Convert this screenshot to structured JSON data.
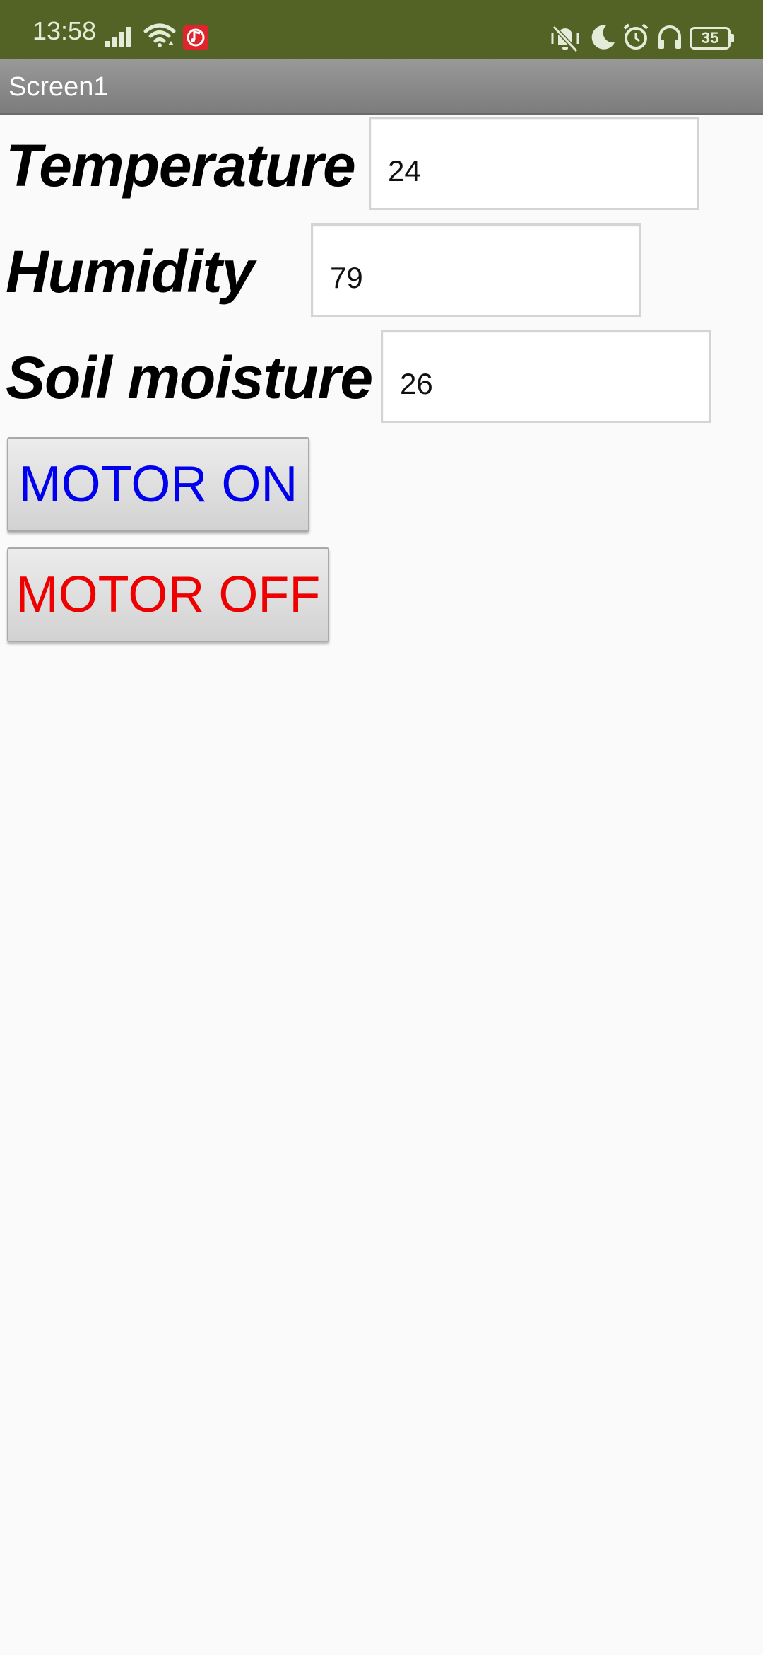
{
  "status_bar": {
    "time": "13:58",
    "battery_level": "35",
    "icons": [
      "signal-icon",
      "wifi-icon",
      "music-app-icon",
      "vibrate-icon",
      "moon-icon",
      "alarm-icon",
      "headphones-icon",
      "battery-icon"
    ]
  },
  "app": {
    "title": "Screen1"
  },
  "rows": [
    {
      "label": "Temperature",
      "value": "24"
    },
    {
      "label": "Humidity",
      "value": "79"
    },
    {
      "label": "Soil moisture",
      "value": "26"
    }
  ],
  "buttons": {
    "motor_on": {
      "label": "MOTOR ON",
      "color": "#0000ee"
    },
    "motor_off": {
      "label": "MOTOR OFF",
      "color": "#ee0000"
    }
  },
  "colors": {
    "status_bar_bg": "#536325",
    "title_bar_bg": "#8a8a8a"
  }
}
